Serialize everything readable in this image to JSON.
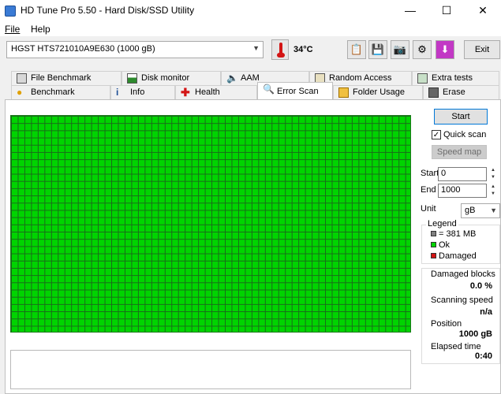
{
  "window": {
    "title": "HD Tune Pro 5.50 - Hard Disk/SSD Utility",
    "minimize": "—",
    "maximize": "☐",
    "close": "✕"
  },
  "menu": {
    "file": "File",
    "help": "Help"
  },
  "toolbar": {
    "drive": "HGST HTS721010A9E630 (1000 gB)",
    "temperature": "34°C",
    "exit_label": "Exit",
    "icons": [
      "copy-text-icon",
      "copy-screenshot-icon",
      "camera-icon",
      "options-icon",
      "save-icon"
    ]
  },
  "tabs_top": [
    {
      "label": "File Benchmark",
      "icon": "file-benchmark-icon"
    },
    {
      "label": "Disk monitor",
      "icon": "disk-monitor-icon"
    },
    {
      "label": "AAM",
      "icon": "speaker-icon"
    },
    {
      "label": "Random Access",
      "icon": "random-access-icon"
    },
    {
      "label": "Extra tests",
      "icon": "extra-tests-icon"
    }
  ],
  "tabs_bottom": [
    {
      "label": "Benchmark",
      "icon": "benchmark-icon"
    },
    {
      "label": "Info",
      "icon": "info-icon"
    },
    {
      "label": "Health",
      "icon": "health-icon"
    },
    {
      "label": "Error Scan",
      "icon": "magnifier-icon",
      "active": true
    },
    {
      "label": "Folder Usage",
      "icon": "folder-icon"
    },
    {
      "label": "Erase",
      "icon": "trash-icon"
    }
  ],
  "controls": {
    "start_label": "Start",
    "quick_scan_label": "Quick scan",
    "quick_scan_checked": true,
    "speed_map_label": "Speed map",
    "start_field_label": "Start",
    "start_value": "0",
    "end_field_label": "End",
    "end_value": "1000",
    "unit_label": "Unit",
    "unit_value": "gB"
  },
  "legend": {
    "title": "Legend",
    "items": [
      {
        "label": "= 381 MB",
        "color": "#808080"
      },
      {
        "label": "Ok",
        "color": "#00d400"
      },
      {
        "label": "Damaged",
        "color": "#d31414"
      }
    ]
  },
  "stats": {
    "damaged_label": "Damaged blocks",
    "damaged_value": "0.0 %",
    "speed_label": "Scanning speed",
    "speed_value": "n/a",
    "position_label": "Position",
    "position_value": "1000 gB",
    "elapsed_label": "Elapsed time",
    "elapsed_value": "0:40"
  },
  "colors": {
    "ok": "#00d400",
    "grid_line": "#1a6b1a",
    "accent": "#0078d7"
  }
}
